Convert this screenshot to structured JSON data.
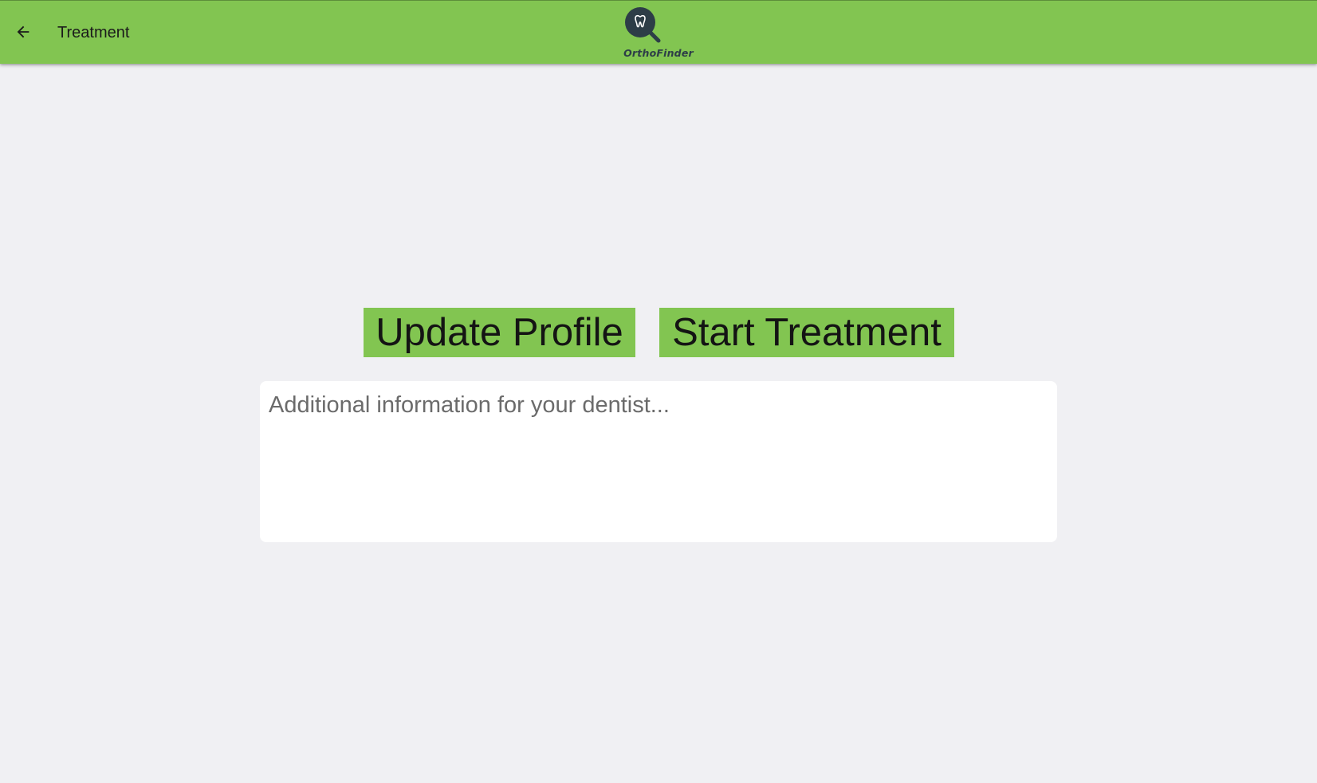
{
  "toolbar": {
    "title": "Treatment",
    "back_icon": "arrow-left-icon",
    "background": "#82c551"
  },
  "logo": {
    "text": "OrthoFinder",
    "icon": "tooth-magnifier-icon"
  },
  "actions": {
    "update_profile_label": "Update Profile",
    "start_treatment_label": "Start Treatment",
    "accent": "#82c551"
  },
  "notes": {
    "placeholder": "Additional information for your dentist...",
    "value": ""
  }
}
